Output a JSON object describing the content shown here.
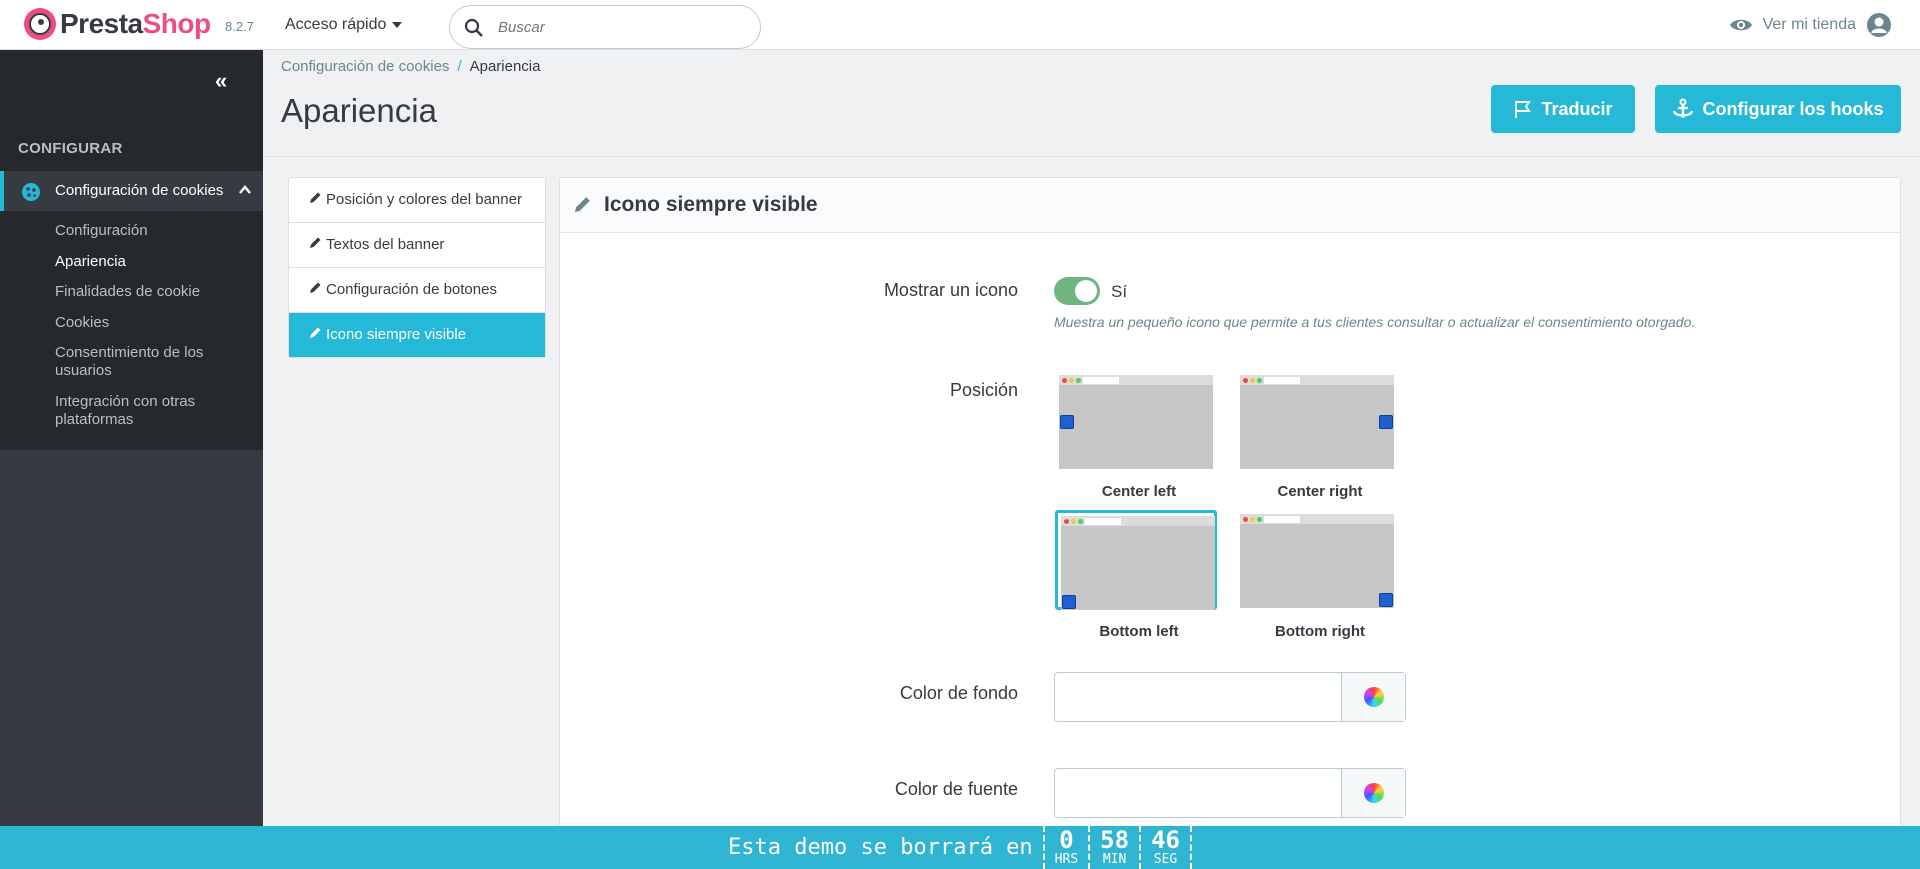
{
  "header": {
    "logo_part1": "Presta",
    "logo_part2": "Shop",
    "version": "8.2.7",
    "quick_access": "Acceso rápido",
    "search_placeholder": "Buscar",
    "view_shop": "Ver mi tienda"
  },
  "sidebar": {
    "section": "CONFIGURAR",
    "active_item": "Configuración de cookies",
    "sub_items": [
      "Configuración",
      "Apariencia",
      "Finalidades de cookie",
      "Cookies",
      "Consentimiento de los usuarios",
      "Integración con otras plataformas"
    ],
    "current_sub": "Apariencia"
  },
  "breadcrumb": {
    "parent": "Configuración de cookies",
    "separator": "/",
    "current": "Apariencia"
  },
  "page_title": "Apariencia",
  "toolbar": {
    "translate": "Traducir",
    "hooks": "Configurar los hooks"
  },
  "tabs": [
    "Posición y colores del banner",
    "Textos del banner",
    "Configuración de botones",
    "Icono siempre visible"
  ],
  "active_tab": "Icono siempre visible",
  "panel": {
    "title": "Icono siempre visible",
    "show_icon_label": "Mostrar un icono",
    "show_icon_value": "Sí",
    "show_icon_help": "Muestra un pequeño icono que permite a tus clientes consultar o actualizar el consentimiento otorgado.",
    "position_label": "Posición",
    "positions": [
      "Center left",
      "Center right",
      "Bottom left",
      "Bottom right"
    ],
    "selected_position": "Bottom left",
    "bg_color_label": "Color de fondo",
    "bg_color_value": "",
    "font_color_label": "Color de fuente",
    "font_color_value": ""
  },
  "demo_banner": {
    "message": "Esta demo se borrará en",
    "hours": "0",
    "hours_label": "HRS",
    "minutes": "58",
    "minutes_label": "MIN",
    "seconds": "46",
    "seconds_label": "SEG"
  },
  "colors": {
    "accent": "#25b9d7",
    "sidebar": "#363a41",
    "sidebar_panel": "#25292e",
    "switch_on": "#70b580",
    "brand_pink": "#ef4c7f"
  }
}
